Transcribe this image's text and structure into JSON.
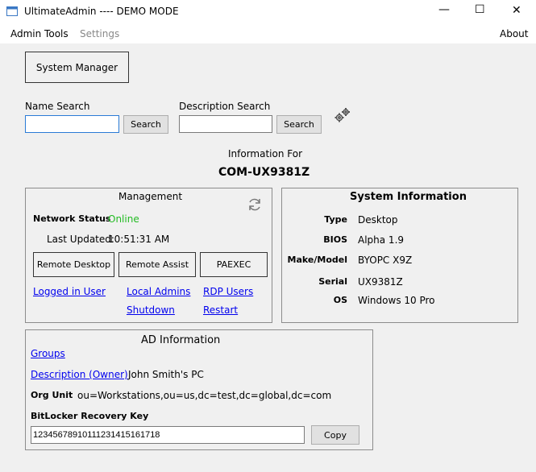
{
  "window": {
    "title": "UltimateAdmin ---- DEMO MODE",
    "minimize": "—",
    "maximize": "☐",
    "close": "✕"
  },
  "menu": {
    "admin_tools": "Admin Tools",
    "settings": "Settings",
    "about": "About"
  },
  "system_manager_label": "System Manager",
  "name_search": {
    "label": "Name Search",
    "value": "",
    "button": "Search"
  },
  "description_search": {
    "label": "Description Search",
    "value": "",
    "button": "Search"
  },
  "info_for_label": "Information For",
  "computer_name": "COM-UX9381Z",
  "management": {
    "title": "Management",
    "network_status_label": "Network Status",
    "network_status_value": "Online",
    "network_status_color": "#22bb22",
    "last_updated_label": "Last Updated:",
    "last_updated_value": "10:51:31 AM",
    "remote_desktop": "Remote Desktop",
    "remote_assist": "Remote Assist",
    "paexec": "PAEXEC",
    "logged_in_user": "Logged in User",
    "local_admins": "Local Admins",
    "rdp_users": "RDP Users",
    "shutdown": "Shutdown",
    "restart": "Restart"
  },
  "system_info": {
    "title": "System Information",
    "rows": [
      {
        "label": "Type",
        "value": "Desktop"
      },
      {
        "label": "BIOS",
        "value": "Alpha 1.9"
      },
      {
        "label": "Make/Model",
        "value": "BYOPC X9Z"
      },
      {
        "label": "Serial",
        "value": "UX9381Z"
      },
      {
        "label": "OS",
        "value": "Windows 10 Pro"
      }
    ]
  },
  "ad_info": {
    "title": "AD Information",
    "groups": "Groups",
    "description_owner_label": "Description (Owner)",
    "description_owner_value": "John Smith's PC",
    "org_unit_label": "Org Unit",
    "org_unit_value": "ou=Workstations,ou=us,dc=test,dc=global,dc=com",
    "bitlocker_label": "BitLocker Recovery Key",
    "bitlocker_value": "12345678910111231415161718",
    "copy_button": "Copy"
  }
}
